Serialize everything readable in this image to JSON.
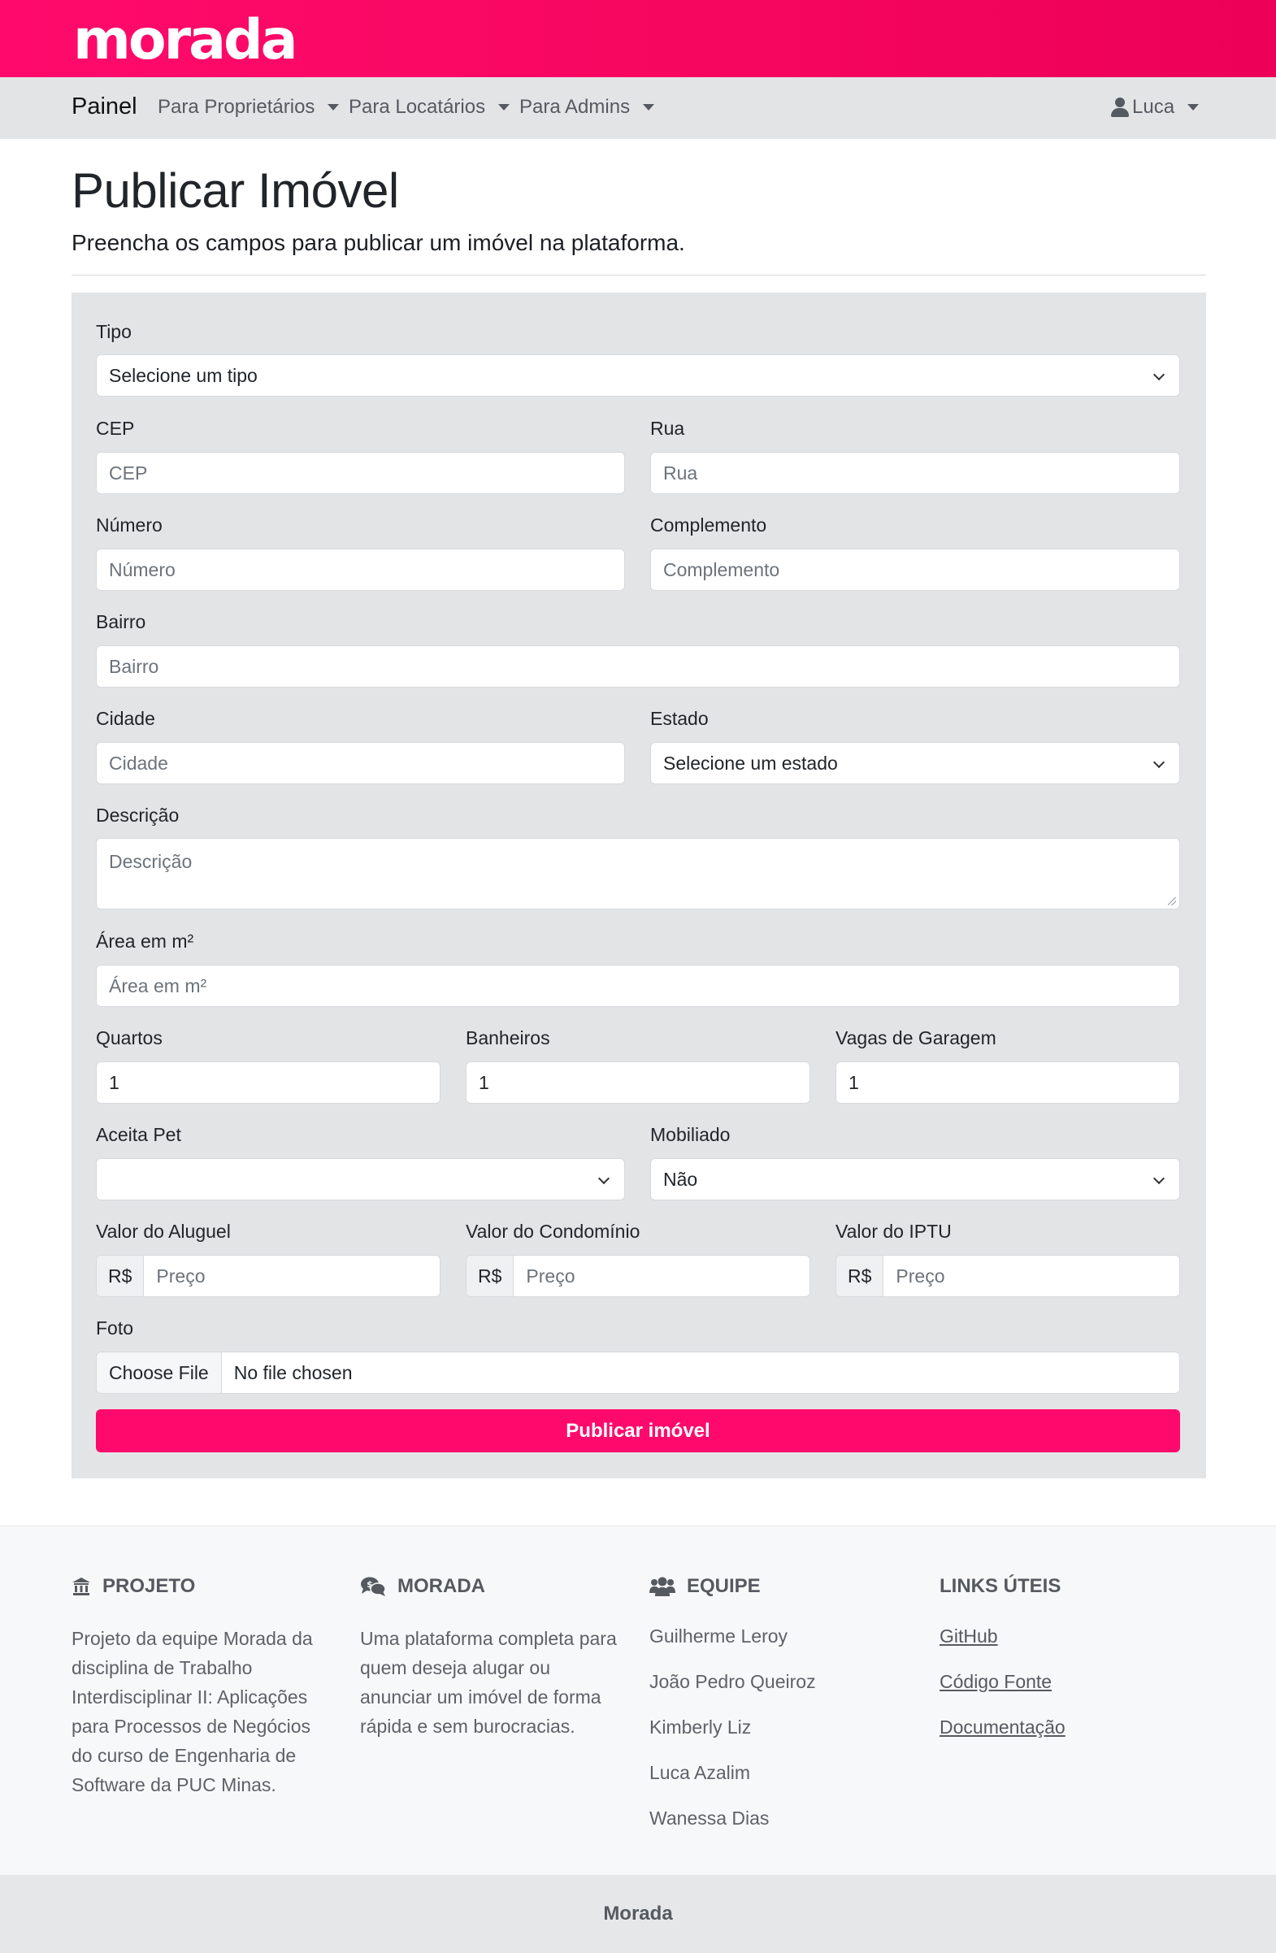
{
  "brand": {
    "logo": "morada",
    "color": "#ff0a6c"
  },
  "navbar": {
    "brand": "Painel",
    "items": [
      {
        "label": "Para Proprietários"
      },
      {
        "label": "Para Locatários"
      },
      {
        "label": "Para Admins"
      }
    ],
    "user": {
      "name": "Luca",
      "icon": "user-icon"
    }
  },
  "page": {
    "title": "Publicar Imóvel",
    "subtitle": "Preencha os campos para publicar um imóvel na plataforma."
  },
  "form": {
    "tipo": {
      "label": "Tipo",
      "value": "Selecione um tipo"
    },
    "cep": {
      "label": "CEP",
      "placeholder": "CEP"
    },
    "rua": {
      "label": "Rua",
      "placeholder": "Rua"
    },
    "numero": {
      "label": "Número",
      "placeholder": "Número"
    },
    "complemento": {
      "label": "Complemento",
      "placeholder": "Complemento"
    },
    "bairro": {
      "label": "Bairro",
      "placeholder": "Bairro"
    },
    "cidade": {
      "label": "Cidade",
      "placeholder": "Cidade"
    },
    "estado": {
      "label": "Estado",
      "value": "Selecione um estado"
    },
    "descricao": {
      "label": "Descrição",
      "placeholder": "Descrição"
    },
    "area": {
      "label": "Área em m²",
      "placeholder": "Área em m²"
    },
    "quartos": {
      "label": "Quartos",
      "value": "1"
    },
    "banheiros": {
      "label": "Banheiros",
      "value": "1"
    },
    "vagas": {
      "label": "Vagas de Garagem",
      "value": "1"
    },
    "aceita_pet": {
      "label": "Aceita Pet",
      "value": ""
    },
    "mobiliado": {
      "label": "Mobiliado",
      "value": "Não"
    },
    "aluguel": {
      "label": "Valor do Aluguel",
      "prefix": "R$",
      "placeholder": "Preço"
    },
    "condominio": {
      "label": "Valor do Condomínio",
      "prefix": "R$",
      "placeholder": "Preço"
    },
    "iptu": {
      "label": "Valor do IPTU",
      "prefix": "R$",
      "placeholder": "Preço"
    },
    "foto": {
      "label": "Foto",
      "button": "Choose File",
      "status": "No file chosen"
    },
    "submit": "Publicar imóvel"
  },
  "footer": {
    "projeto": {
      "title": "PROJETO",
      "icon": "bank-icon",
      "text": "Projeto da equipe Morada da disciplina de Trabalho Interdisciplinar II: Aplicações para Processos de Negócios do curso de Engenharia de Software da PUC Minas."
    },
    "morada": {
      "title": "MORADA",
      "icon": "comments-dollar-icon",
      "text": "Uma plataforma completa para quem deseja alugar ou anunciar um imóvel de forma rápida e sem burocracias."
    },
    "equipe": {
      "title": "EQUIPE",
      "icon": "users-icon",
      "members": [
        "Guilherme Leroy",
        "João Pedro Queiroz",
        "Kimberly Liz",
        "Luca Azalim",
        "Wanessa Dias"
      ]
    },
    "links": {
      "title": "LINKS ÚTEIS",
      "items": [
        "GitHub",
        "Código Fonte",
        "Documentação"
      ]
    },
    "copyright": "Morada"
  }
}
